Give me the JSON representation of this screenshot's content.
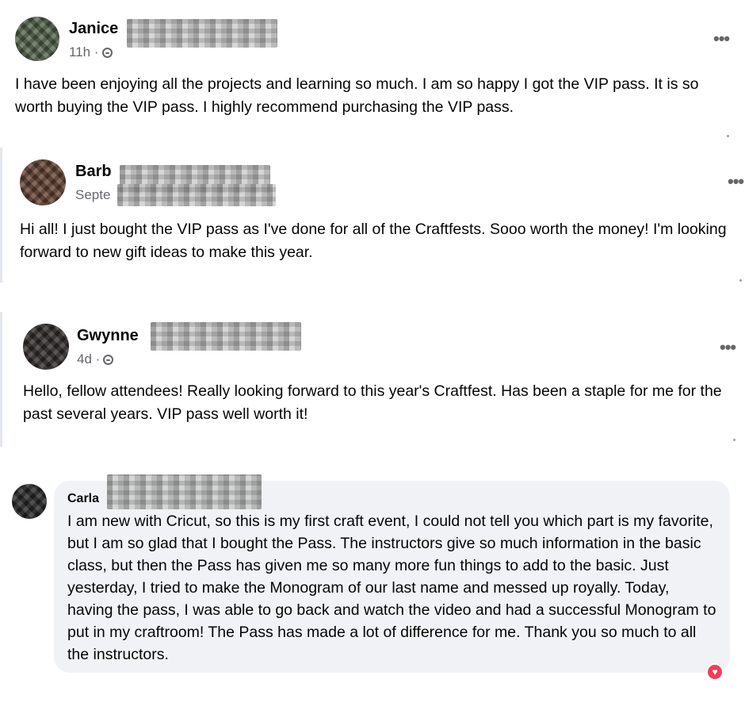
{
  "posts": [
    {
      "name": "Janice",
      "meta": "11h ·",
      "text": "I have been enjoying all the projects and learning so much. I am so happy I got the VIP pass. It is so worth buying the VIP pass. I highly recommend purchasing the VIP pass.",
      "more_icon": "more-options-icon"
    },
    {
      "name": "Barb",
      "meta": "Septe",
      "text": "Hi all! I just bought the VIP pass as I've done for all of the Craftfests. Sooo worth the money! I'm looking forward to new gift ideas to make this year.",
      "more_icon": "more-options-icon"
    },
    {
      "name": "Gwynne",
      "meta": "4d ·",
      "text": "Hello, fellow attendees! Really looking forward to this year's Craftfest. Has been a staple for me for the past several years. VIP pass well worth it!",
      "more_icon": "more-options-icon"
    }
  ],
  "comment": {
    "name": "Carla",
    "text": "I am new with Cricut, so this is my first craft event,  I could not tell you which part is my favorite, but I am so glad that I bought the Pass. The instructors give so much information in the basic class, but then the Pass has given me so many more fun things to add to the basic. Just yesterday, I tried to make the Monogram of our last name and messed up royally. Today, having the pass, I was able to go back and watch the video and had a successful Monogram to put in my craftroom! The Pass has made a lot of difference for me. Thank you so much to all the instructors.",
    "reaction_icon": "heart-reaction-icon"
  },
  "ui": {
    "more_glyph": "•••",
    "reaction_glyph": "♥"
  },
  "colors": {
    "secondary_text": "#65676b",
    "bubble_bg": "#f0f2f5",
    "reaction": "#f33e58"
  }
}
